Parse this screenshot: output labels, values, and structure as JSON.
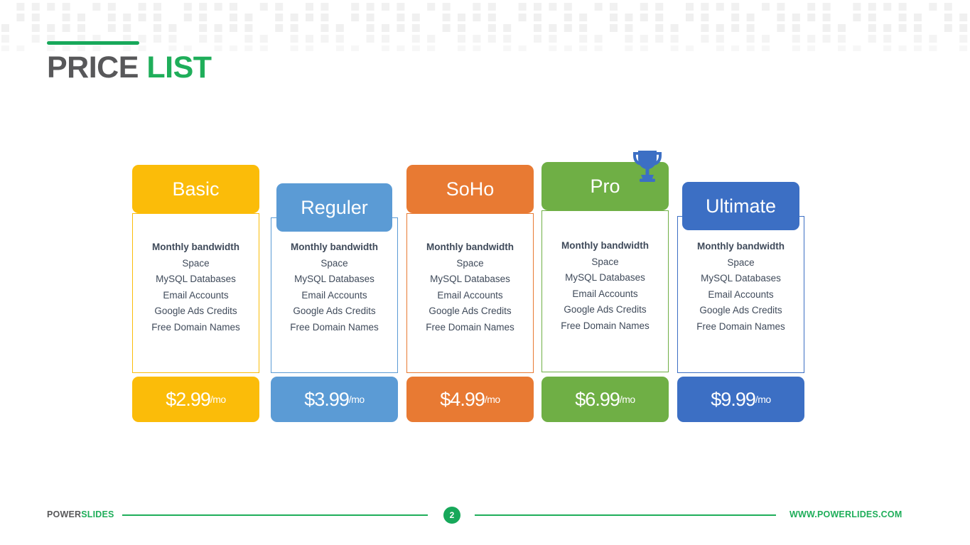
{
  "title": {
    "part1": "PRICE",
    "part2": "LIST"
  },
  "features": [
    "Monthly bandwidth",
    "Space",
    "MySQL Databases",
    "Email  Accounts",
    "Google Ads Credits",
    "Free Domain Names"
  ],
  "plans": [
    {
      "name": "Basic",
      "price_main": "$2.99",
      "price_unit": "/mo",
      "color": "#FBBC09",
      "features": [
        "Monthly bandwidth",
        "Space",
        "MySQL Databases",
        "Email  Accounts",
        "Google Ads Credits",
        "Free Domain Names"
      ],
      "featured": false
    },
    {
      "name": "Reguler",
      "price_main": "$3.99",
      "price_unit": "/mo",
      "color": "#5B9BD5",
      "features": [
        "Monthly bandwidth",
        "Space",
        "MySQL Databases",
        "Email  Accounts",
        "Google Ads Credits",
        "Free Domain Names"
      ],
      "featured": false
    },
    {
      "name": "SoHo",
      "price_main": "$4.99",
      "price_unit": "/mo",
      "color": "#E87A33",
      "features": [
        "Monthly bandwidth",
        "Space",
        "MySQL Databases",
        "Email  Accounts",
        "Google Ads Credits",
        "Free Domain Names"
      ],
      "featured": false
    },
    {
      "name": "Pro",
      "price_main": "$6.99",
      "price_unit": "/mo",
      "color": "#6FAF45",
      "features": [
        "Monthly bandwidth",
        "Space",
        "MySQL Databases",
        "Email  Accounts",
        "Google Ads Credits",
        "Free Domain Names"
      ],
      "featured": true,
      "badge_icon": "trophy-icon",
      "badge_color": "#3C6FC4"
    },
    {
      "name": "Ultimate",
      "price_main": "$9.99",
      "price_unit": "/mo",
      "color": "#3C6FC4",
      "features": [
        "Monthly bandwidth",
        "Space",
        "MySQL Databases",
        "Email  Accounts",
        "Google Ads Credits",
        "Free Domain Names"
      ],
      "featured": false
    }
  ],
  "footer": {
    "logo_part1": "POWER",
    "logo_part2": "SLIDES",
    "page_number": "2",
    "url": "WWW.POWERLIDES.COM"
  },
  "colors": {
    "green_accent": "#1fae5a",
    "title_dark": "#58585a",
    "body_text": "#3f4a5a",
    "dot_pattern": "#f0f0f0"
  }
}
